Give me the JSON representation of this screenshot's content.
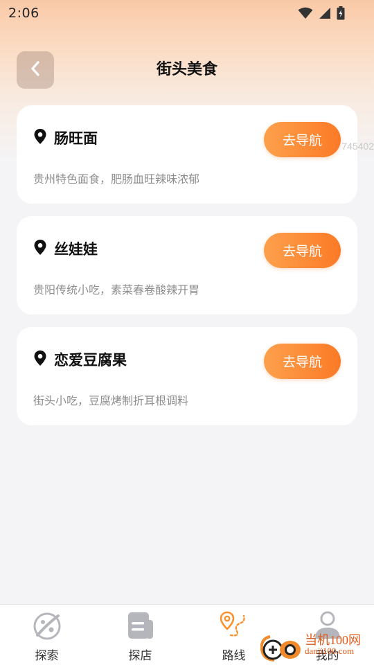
{
  "status_bar": {
    "time": "2:06"
  },
  "header": {
    "title": "街头美食"
  },
  "cards": [
    {
      "title": "肠旺面",
      "desc": "贵州特色面食，肥肠血旺辣味浓郁",
      "button": "去导航"
    },
    {
      "title": "丝娃娃",
      "desc": "贵阳传统小吃，素菜春卷酸辣开胃",
      "button": "去导航"
    },
    {
      "title": "恋爱豆腐果",
      "desc": "街头小吃，豆腐烤制折耳根调料",
      "button": "去导航"
    }
  ],
  "overlay_id": "745402",
  "tabbar": {
    "items": [
      {
        "label": "探索",
        "icon": "planet-icon"
      },
      {
        "label": "探店",
        "icon": "document-icon"
      },
      {
        "label": "路线",
        "icon": "route-icon"
      },
      {
        "label": "我的",
        "icon": "user-icon"
      }
    ]
  },
  "watermark": {
    "line1": "当机100网",
    "line2": "danji100.com"
  },
  "colors": {
    "accent": "#fb7a26",
    "accent_light": "#fda04c",
    "icon_gray": "#b4b6bb"
  }
}
